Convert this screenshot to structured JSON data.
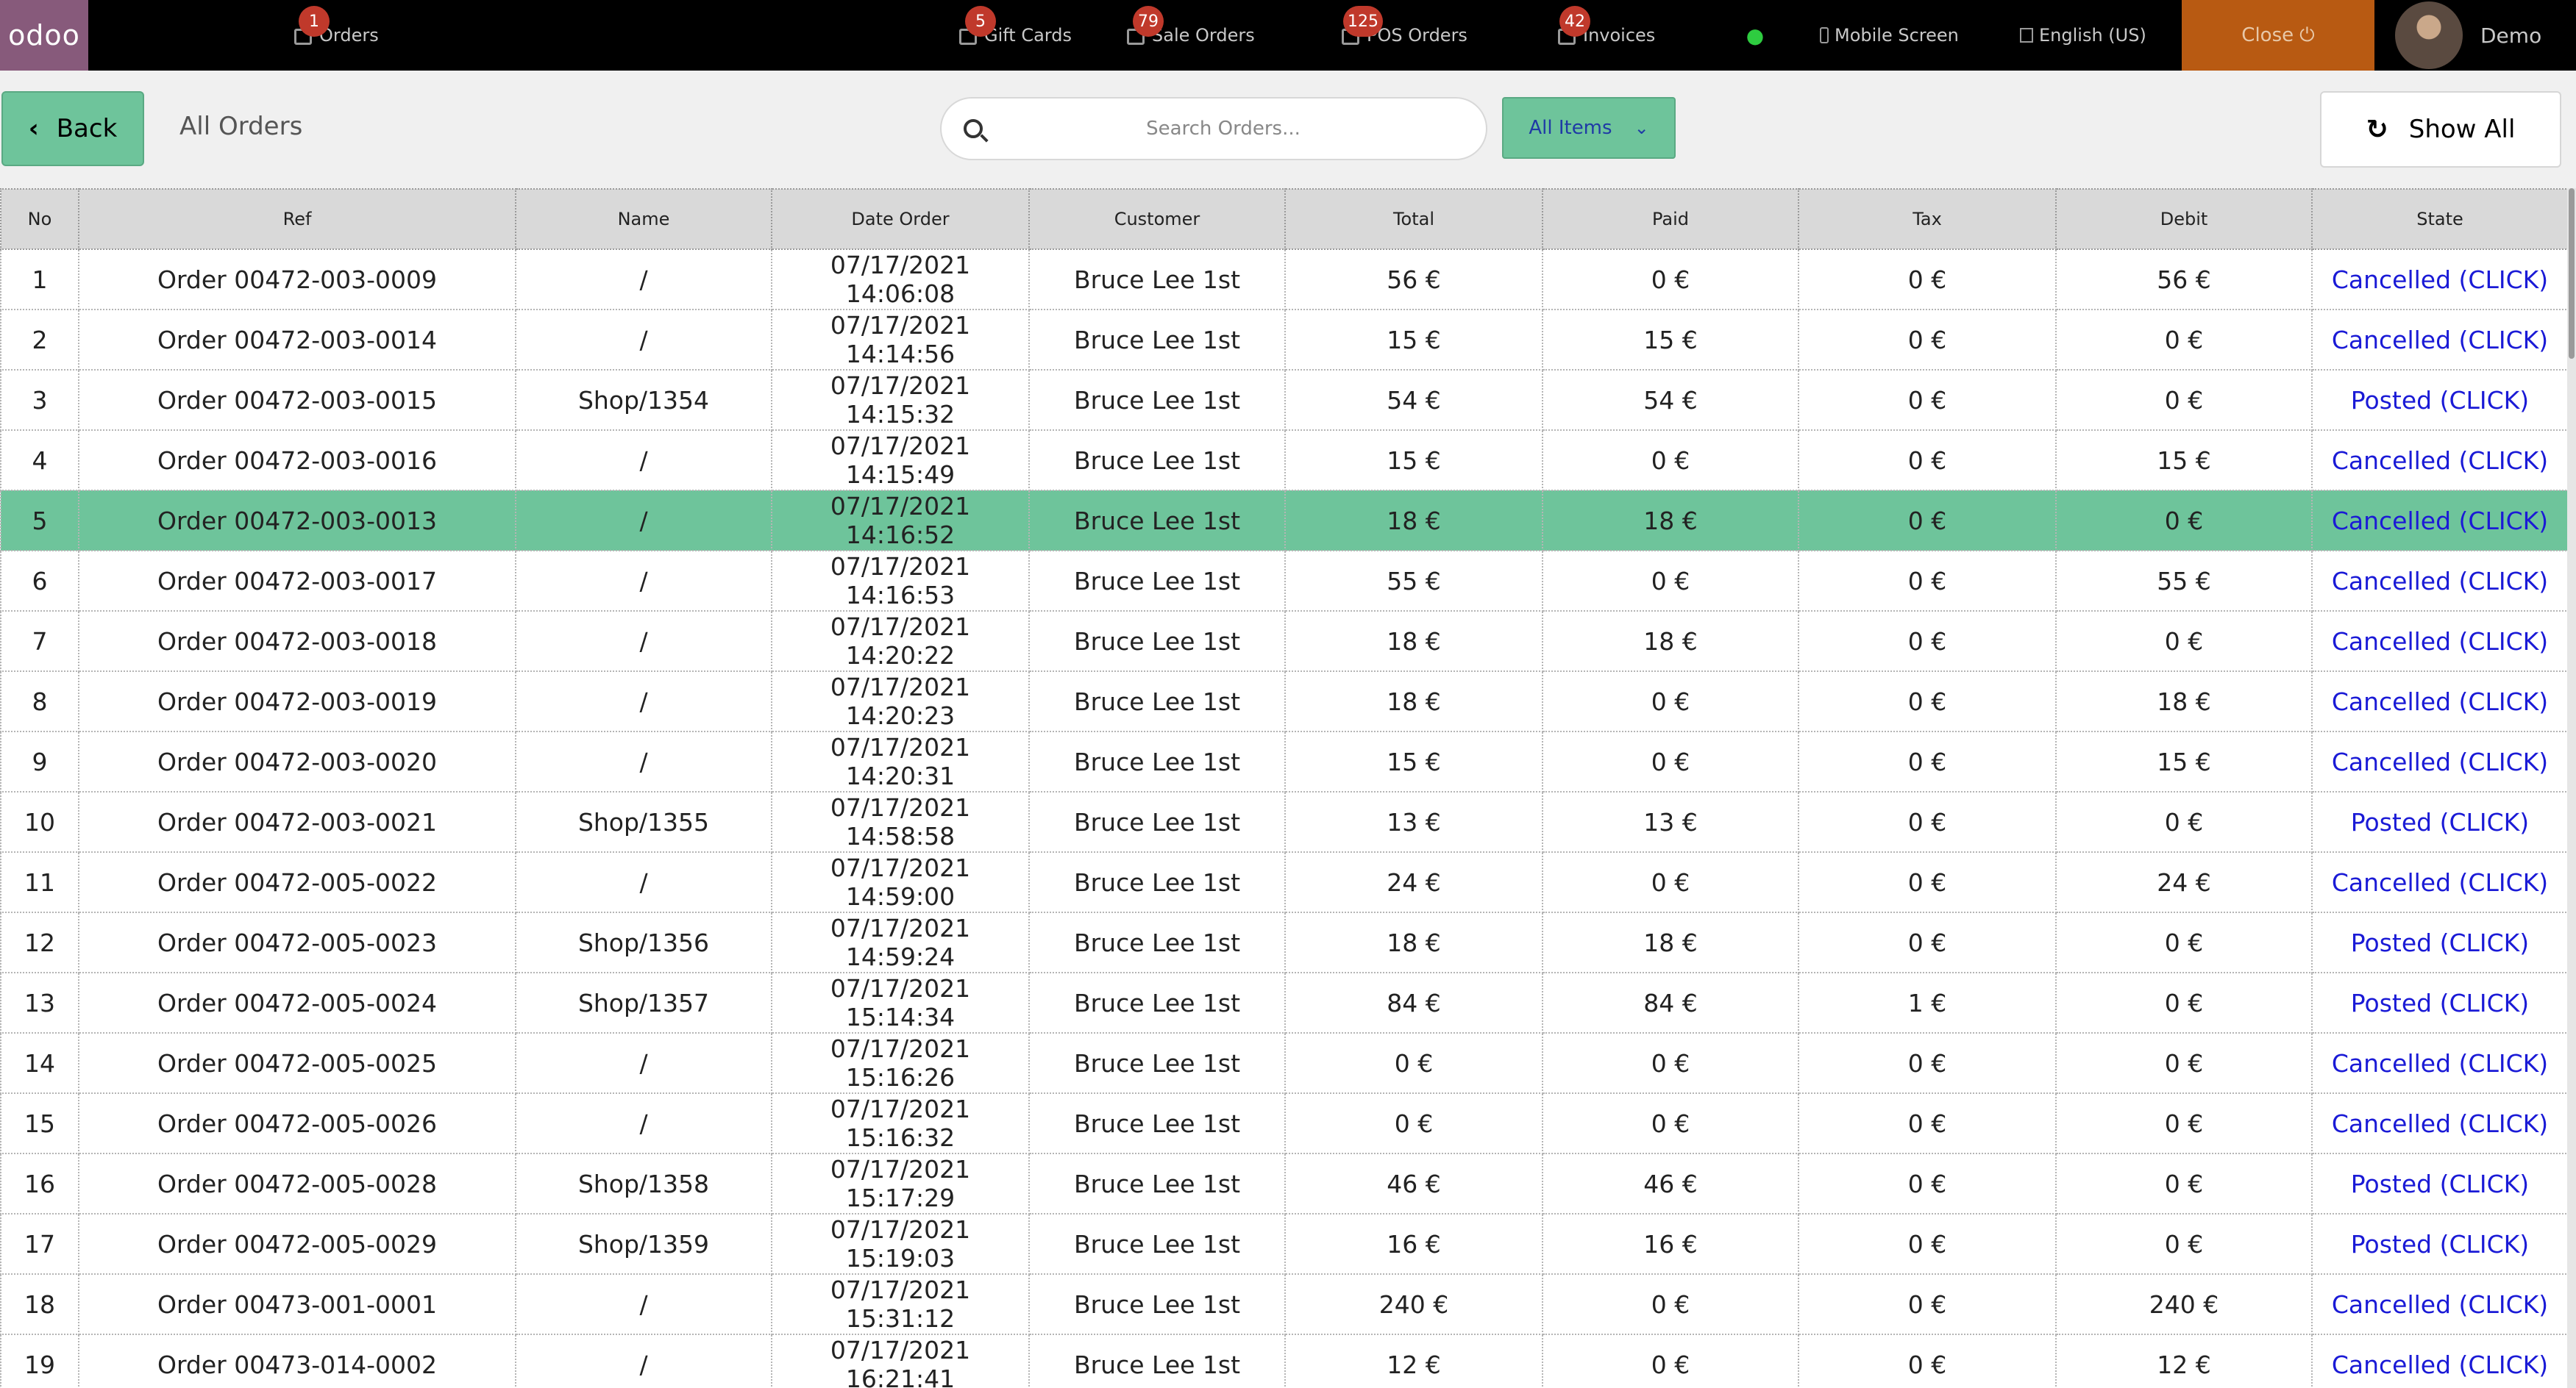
{
  "navbar": {
    "logo": "odoo",
    "items": [
      {
        "label": "Orders",
        "badge": "1",
        "icon": "orders-icon"
      },
      {
        "label": "Gift Cards",
        "badge": "5",
        "icon": "gift-card-icon"
      },
      {
        "label": "Sale Orders",
        "badge": "79",
        "icon": "sale-orders-icon"
      },
      {
        "label": "POS Orders",
        "badge": "125",
        "icon": "pos-orders-icon"
      },
      {
        "label": "Invoices",
        "badge": "42",
        "icon": "invoices-icon"
      }
    ],
    "mobile_screen": "Mobile Screen",
    "language": "English (US)",
    "close": "Close",
    "username": "Demo"
  },
  "controls": {
    "back": "Back",
    "title": "All Orders",
    "search_placeholder": "Search Orders...",
    "filter": "All Items",
    "show_all": "Show All"
  },
  "table": {
    "columns": [
      "No",
      "Ref",
      "Name",
      "Date Order",
      "Customer",
      "Total",
      "Paid",
      "Tax",
      "Debit",
      "State"
    ],
    "selected_row": 5,
    "rows": [
      [
        "1",
        "Order 00472-003-0009",
        "/",
        "07/17/2021 14:06:08",
        "Bruce Lee 1st",
        "56 €",
        "0 €",
        "0 €",
        "56 €",
        "Cancelled (CLICK)"
      ],
      [
        "2",
        "Order 00472-003-0014",
        "/",
        "07/17/2021 14:14:56",
        "Bruce Lee 1st",
        "15 €",
        "15 €",
        "0 €",
        "0 €",
        "Cancelled (CLICK)"
      ],
      [
        "3",
        "Order 00472-003-0015",
        "Shop/1354",
        "07/17/2021 14:15:32",
        "Bruce Lee 1st",
        "54 €",
        "54 €",
        "0 €",
        "0 €",
        "Posted (CLICK)"
      ],
      [
        "4",
        "Order 00472-003-0016",
        "/",
        "07/17/2021 14:15:49",
        "Bruce Lee 1st",
        "15 €",
        "0 €",
        "0 €",
        "15 €",
        "Cancelled (CLICK)"
      ],
      [
        "5",
        "Order 00472-003-0013",
        "/",
        "07/17/2021 14:16:52",
        "Bruce Lee 1st",
        "18 €",
        "18 €",
        "0 €",
        "0 €",
        "Cancelled (CLICK)"
      ],
      [
        "6",
        "Order 00472-003-0017",
        "/",
        "07/17/2021 14:16:53",
        "Bruce Lee 1st",
        "55 €",
        "0 €",
        "0 €",
        "55 €",
        "Cancelled (CLICK)"
      ],
      [
        "7",
        "Order 00472-003-0018",
        "/",
        "07/17/2021 14:20:22",
        "Bruce Lee 1st",
        "18 €",
        "18 €",
        "0 €",
        "0 €",
        "Cancelled (CLICK)"
      ],
      [
        "8",
        "Order 00472-003-0019",
        "/",
        "07/17/2021 14:20:23",
        "Bruce Lee 1st",
        "18 €",
        "0 €",
        "0 €",
        "18 €",
        "Cancelled (CLICK)"
      ],
      [
        "9",
        "Order 00472-003-0020",
        "/",
        "07/17/2021 14:20:31",
        "Bruce Lee 1st",
        "15 €",
        "0 €",
        "0 €",
        "15 €",
        "Cancelled (CLICK)"
      ],
      [
        "10",
        "Order 00472-003-0021",
        "Shop/1355",
        "07/17/2021 14:58:58",
        "Bruce Lee 1st",
        "13 €",
        "13 €",
        "0 €",
        "0 €",
        "Posted (CLICK)"
      ],
      [
        "11",
        "Order 00472-005-0022",
        "/",
        "07/17/2021 14:59:00",
        "Bruce Lee 1st",
        "24 €",
        "0 €",
        "0 €",
        "24 €",
        "Cancelled (CLICK)"
      ],
      [
        "12",
        "Order 00472-005-0023",
        "Shop/1356",
        "07/17/2021 14:59:24",
        "Bruce Lee 1st",
        "18 €",
        "18 €",
        "0 €",
        "0 €",
        "Posted (CLICK)"
      ],
      [
        "13",
        "Order 00472-005-0024",
        "Shop/1357",
        "07/17/2021 15:14:34",
        "Bruce Lee 1st",
        "84 €",
        "84 €",
        "1 €",
        "0 €",
        "Posted (CLICK)"
      ],
      [
        "14",
        "Order 00472-005-0025",
        "/",
        "07/17/2021 15:16:26",
        "Bruce Lee 1st",
        "0 €",
        "0 €",
        "0 €",
        "0 €",
        "Cancelled (CLICK)"
      ],
      [
        "15",
        "Order 00472-005-0026",
        "/",
        "07/17/2021 15:16:32",
        "Bruce Lee 1st",
        "0 €",
        "0 €",
        "0 €",
        "0 €",
        "Cancelled (CLICK)"
      ],
      [
        "16",
        "Order 00472-005-0028",
        "Shop/1358",
        "07/17/2021 15:17:29",
        "Bruce Lee 1st",
        "46 €",
        "46 €",
        "0 €",
        "0 €",
        "Posted (CLICK)"
      ],
      [
        "17",
        "Order 00472-005-0029",
        "Shop/1359",
        "07/17/2021 15:19:03",
        "Bruce Lee 1st",
        "16 €",
        "16 €",
        "0 €",
        "0 €",
        "Posted (CLICK)"
      ],
      [
        "18",
        "Order 00473-001-0001",
        "/",
        "07/17/2021 15:31:12",
        "Bruce Lee 1st",
        "240 €",
        "0 €",
        "0 €",
        "240 €",
        "Cancelled (CLICK)"
      ],
      [
        "19",
        "Order 00473-014-0002",
        "/",
        "07/17/2021 16:21:41",
        "Bruce Lee 1st",
        "12 €",
        "0 €",
        "0 €",
        "12 €",
        "Cancelled (CLICK)"
      ]
    ]
  },
  "colors": {
    "accent_green": "#6ec49b",
    "brand_purple": "#875a7b",
    "close_orange": "#b85a12",
    "badge_red": "#c0392b",
    "link_blue": "#1a1ad6"
  }
}
